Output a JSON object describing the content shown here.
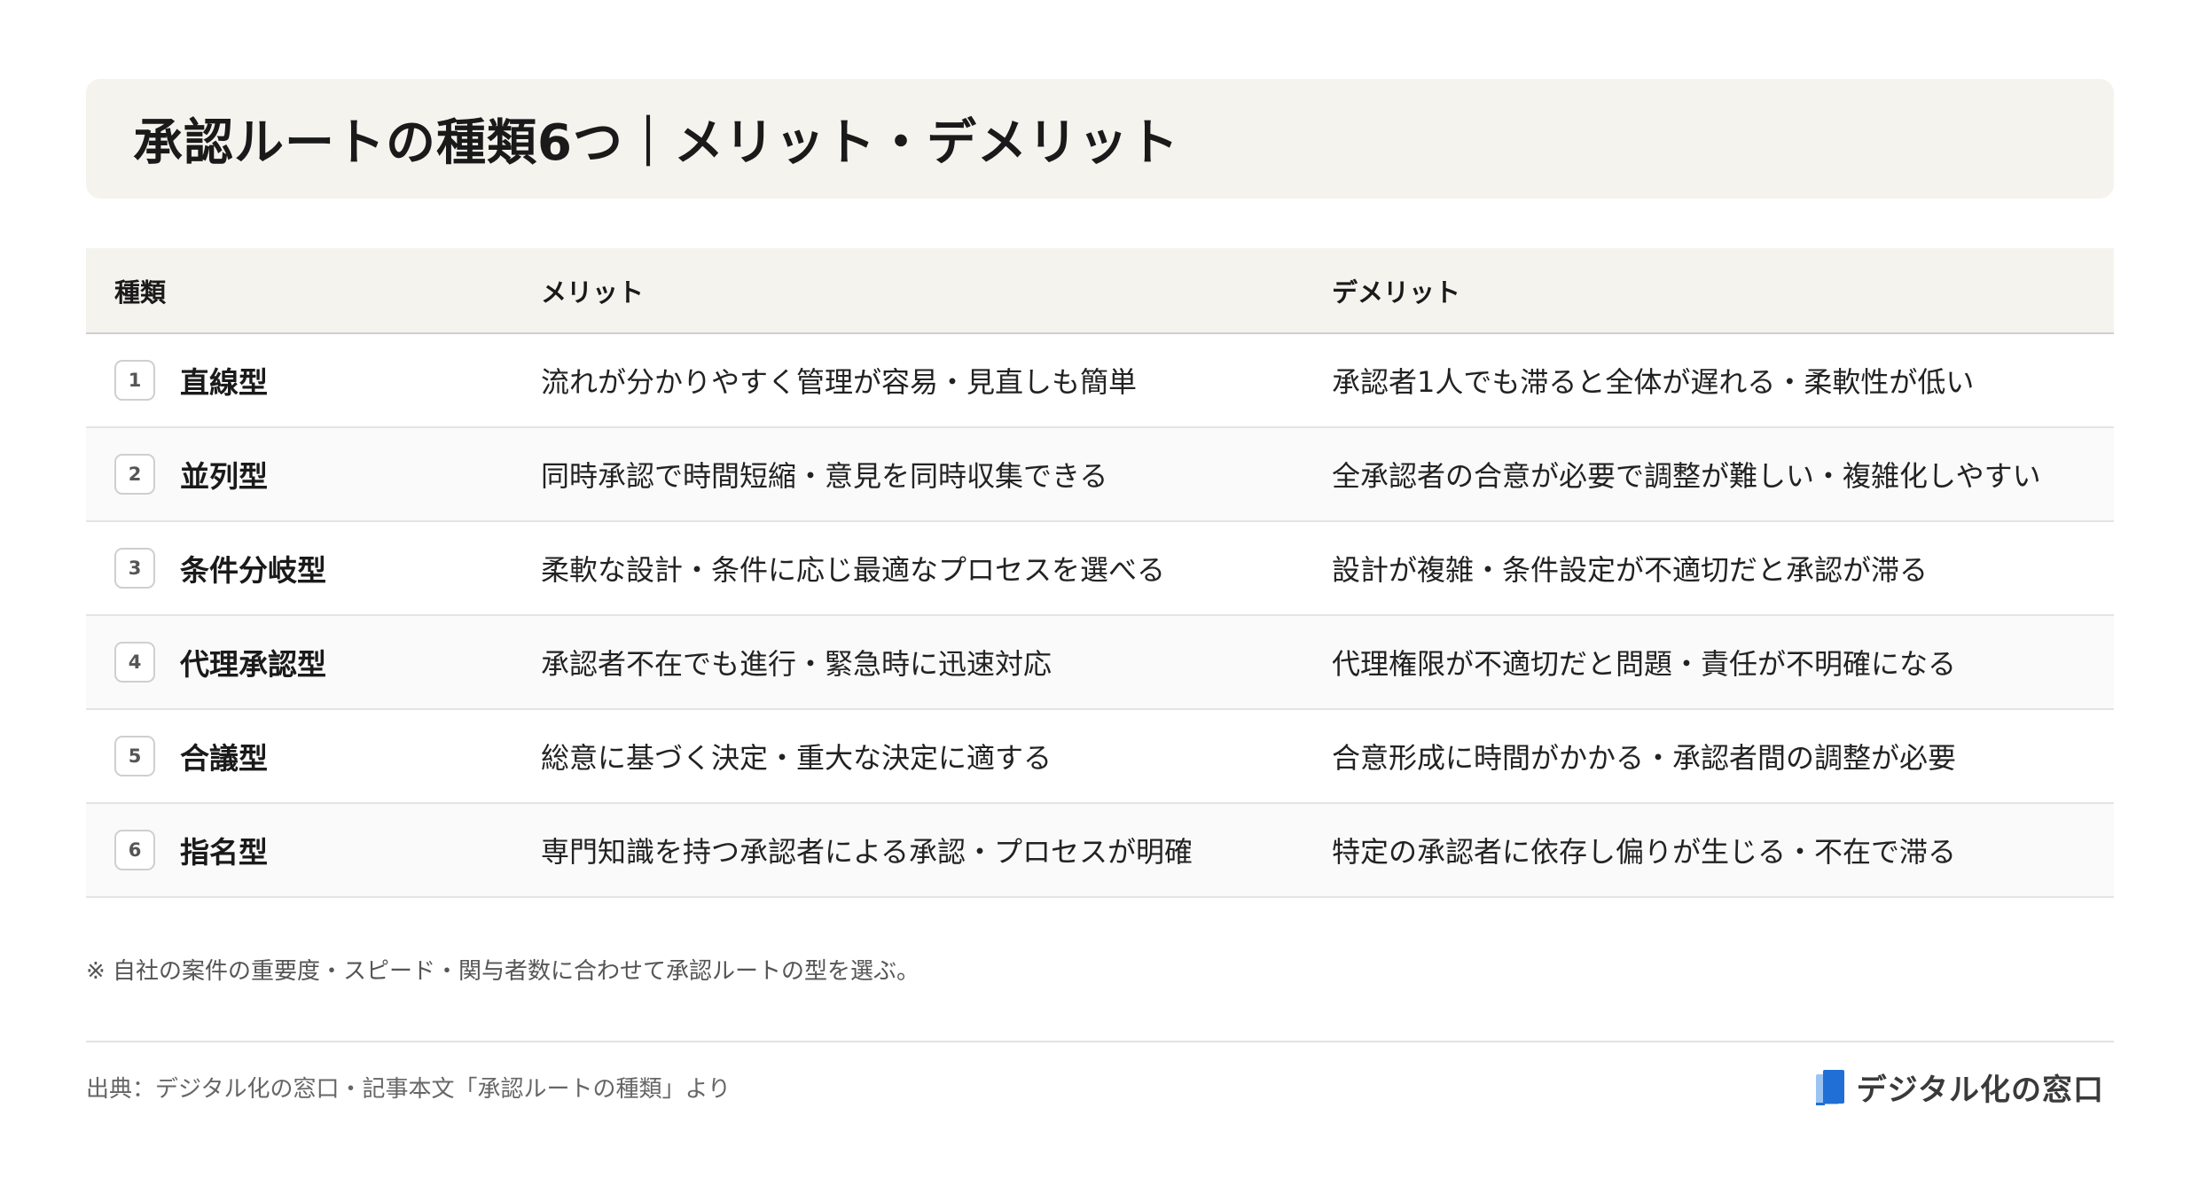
{
  "title": "承認ルートの種類6つ｜メリット・デメリット",
  "table": {
    "headers": {
      "type": "種類",
      "merit": "メリット",
      "demerit": "デメリット"
    },
    "rows": [
      {
        "num": "1",
        "type": "直線型",
        "merit": "流れが分かりやすく管理が容易・見直しも簡単",
        "demerit": "承認者1人でも滞ると全体が遅れる・柔軟性が低い"
      },
      {
        "num": "2",
        "type": "並列型",
        "merit": "同時承認で時間短縮・意見を同時収集できる",
        "demerit": "全承認者の合意が必要で調整が難しい・複雑化しやすい"
      },
      {
        "num": "3",
        "type": "条件分岐型",
        "merit": "柔軟な設計・条件に応じ最適なプロセスを選べる",
        "demerit": "設計が複雑・条件設定が不適切だと承認が滞る"
      },
      {
        "num": "4",
        "type": "代理承認型",
        "merit": "承認者不在でも進行・緊急時に迅速対応",
        "demerit": "代理権限が不適切だと問題・責任が不明確になる"
      },
      {
        "num": "5",
        "type": "合議型",
        "merit": "総意に基づく決定・重大な決定に適する",
        "demerit": "合意形成に時間がかかる・承認者間の調整が必要"
      },
      {
        "num": "6",
        "type": "指名型",
        "merit": "専門知識を持つ承認者による承認・プロセスが明確",
        "demerit": "特定の承認者に依存し偏りが生じる・不在で滞る"
      }
    ]
  },
  "note": "※ 自社の案件の重要度・スピード・関与者数に合わせて承認ルートの型を選ぶ。",
  "footer": {
    "source": "出典：デジタル化の窓口・記事本文「承認ルートの種類」より",
    "brand_name": "デジタル化の窓口",
    "brand_icon": "document-logo-icon",
    "brand_color": "#1f6fd6"
  }
}
